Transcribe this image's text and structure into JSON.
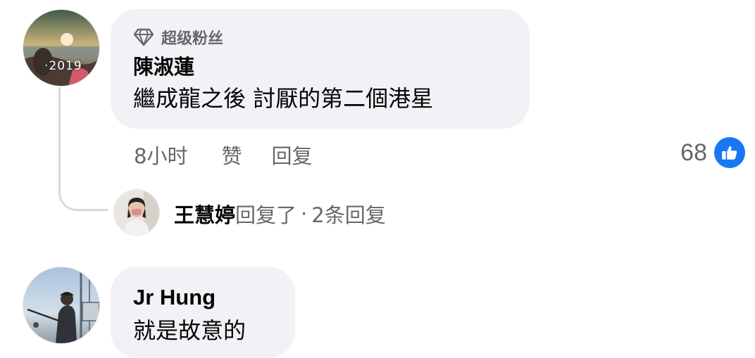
{
  "comments": [
    {
      "badge_icon": "diamond-icon",
      "badge_label": "超级粉丝",
      "author": "陳淑蓮",
      "text": "繼成龍之後 討厭的第二個港星",
      "avatar_caption": "·2019",
      "time": "8小时",
      "like_label": "赞",
      "reply_label": "回复",
      "reaction_count": "68",
      "reaction_icon": "thumbs-up-icon",
      "reaction_color": "#1877f2",
      "replies": {
        "replier": "王慧婷",
        "action_text": "回复了",
        "separator": "·",
        "count_text": "2条回复"
      }
    },
    {
      "author": "Jr Hung",
      "text": "就是故意的"
    }
  ]
}
